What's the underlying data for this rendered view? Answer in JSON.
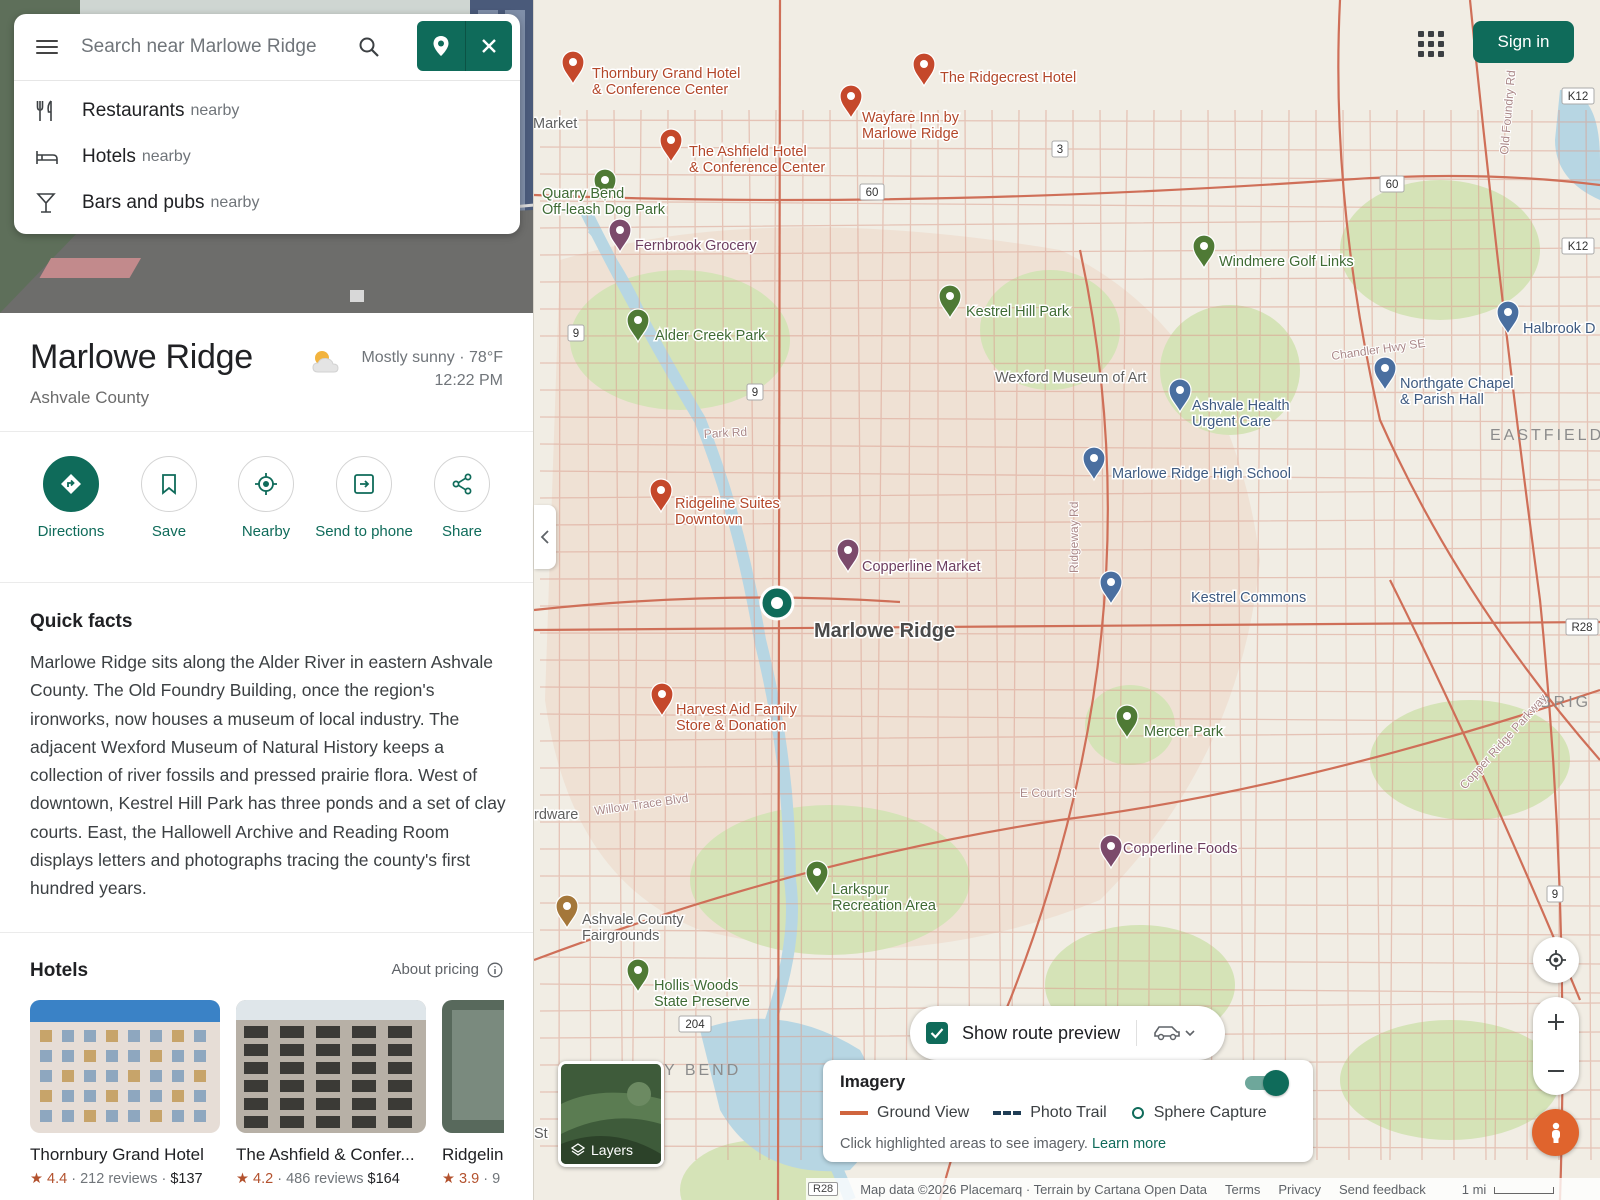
{
  "search": {
    "placeholder": "Search near Marlowe Ridge"
  },
  "suggestions": [
    {
      "label": "Restaurants",
      "sub": "nearby",
      "icon": "utensils-icon"
    },
    {
      "label": "Hotels",
      "sub": "nearby",
      "icon": "bed-icon"
    },
    {
      "label": "Bars and pubs",
      "sub": "nearby",
      "icon": "cocktail-icon"
    }
  ],
  "place": {
    "name": "Marlowe Ridge",
    "county": "Ashvale County",
    "weather_line1": "Mostly sunny · 78°F",
    "weather_line2": "12:22 PM",
    "weather_icon": "partly-sunny-icon"
  },
  "actions": [
    {
      "label": "Directions",
      "icon": "directions-icon"
    },
    {
      "label": "Save",
      "icon": "bookmark-icon"
    },
    {
      "label": "Nearby",
      "icon": "nearby-icon"
    },
    {
      "label": "Send to phone",
      "icon": "send-icon"
    },
    {
      "label": "Share",
      "icon": "share-icon"
    }
  ],
  "quick_facts": {
    "title": "Quick facts",
    "body": "Marlowe Ridge sits along the Alder River in eastern Ashvale County. The Old Foundry Building, once the region's ironworks, now houses a museum of local industry. The adjacent Wexford Museum of Natural History keeps a collection of river fossils and pressed prairie flora. West of downtown, Kestrel Hill Park has three ponds and a set of clay courts. East, the Hallowell Archive and Reading Room displays letters and photographs tracing the county's first hundred years."
  },
  "hotels": {
    "title": "Hotels",
    "about_pricing": "About pricing",
    "items": [
      {
        "name": "Thornbury Grand Hotel",
        "rating": "4.4",
        "reviews": "212 reviews",
        "price": "$137"
      },
      {
        "name": "The Ashfield & Confer...",
        "rating": "4.2",
        "reviews": "486 reviews",
        "price": "$164"
      },
      {
        "name": "Ridgelin",
        "rating": "3.9",
        "reviews": "9",
        "price": ""
      }
    ]
  },
  "header": {
    "sign_in": "Sign in"
  },
  "map": {
    "center_label": "Marlowe Ridge",
    "area_labels": [
      "EASTFIELD",
      "BRIG",
      "Y BEND"
    ],
    "pois": [
      {
        "name": "Thornbury Grand Hotel\n& Conference Center",
        "cat": "hotel"
      },
      {
        "name": "The Ridgecrest Hotel",
        "cat": "hotel"
      },
      {
        "name": "Wayfare Inn by\nMarlowe Ridge",
        "cat": "hotel"
      },
      {
        "name": "The Ashfield Hotel\n& Conference Center",
        "cat": "hotel"
      },
      {
        "name": "Quarry Bend\nOff-leash Dog Park",
        "cat": "park"
      },
      {
        "name": "Fernbrook Grocery",
        "cat": "shop"
      },
      {
        "name": "Windmere Golf Links",
        "cat": "park"
      },
      {
        "name": "Kestrel Hill Park",
        "cat": "park"
      },
      {
        "name": "Alder Creek Park",
        "cat": "park"
      },
      {
        "name": "Wexford Museum of Art",
        "cat": "label"
      },
      {
        "name": "Ashvale Health\nUrgent Care",
        "cat": "civic"
      },
      {
        "name": "Halbrook D",
        "cat": "civic"
      },
      {
        "name": "Northgate Chapel\n& Parish Hall",
        "cat": "civic"
      },
      {
        "name": "Marlowe Ridge High School",
        "cat": "civic"
      },
      {
        "name": "Ridgeline Suites\nDowntown",
        "cat": "hotel"
      },
      {
        "name": "Copperline Market",
        "cat": "shop"
      },
      {
        "name": "Kestrel Commons",
        "cat": "civic"
      },
      {
        "name": "Harvest Aid Family\nStore & Donation",
        "cat": "hotel"
      },
      {
        "name": "Mercer Park",
        "cat": "park"
      },
      {
        "name": "Copperline Foods",
        "cat": "shop"
      },
      {
        "name": "Larkspur\nRecreation Area",
        "cat": "park"
      },
      {
        "name": "Ashvale County\nFairgrounds",
        "cat": "other"
      },
      {
        "name": "Hollis Woods\nState Preserve",
        "cat": "park"
      },
      {
        "name": "Market",
        "cat": "label"
      },
      {
        "name": "rdware",
        "cat": "label"
      },
      {
        "name": "St",
        "cat": "label"
      }
    ],
    "road_labels": [
      "Park Rd",
      "Willow Trace Blvd",
      "E Court St",
      "Ridgeway Rd",
      "Chandler Hwy SE",
      "Old Foundry Rd",
      "Copper Ridge Parkway"
    ],
    "shields": [
      "3",
      "60",
      "60",
      "9",
      "9",
      "204",
      "9",
      "K12",
      "K12",
      "R28"
    ]
  },
  "controls": {
    "layers_label": "Layers",
    "route_preview_label": "Show route preview",
    "route_mode_icon": "car-icon"
  },
  "imagery": {
    "title": "Imagery",
    "enabled": true,
    "legend": [
      "Ground View",
      "Photo Trail",
      "Sphere Capture"
    ],
    "hint": "Click highlighted areas to see imagery.",
    "learn_more": "Learn more"
  },
  "attribution": {
    "shield": "R28",
    "map_data": "Map data ©2026 Placemarq · Terrain by Cartana Open Data",
    "terms": "Terms",
    "privacy": "Privacy",
    "feedback": "Send feedback",
    "scale": "1 mi"
  },
  "colors": {
    "accent": "#0f6b5a",
    "hotel_pin": "#c5482b",
    "park_pin": "#4f7a35",
    "civic_pin": "#4a6fa0",
    "shop_pin": "#7b4a6b",
    "road": "#d08878"
  }
}
